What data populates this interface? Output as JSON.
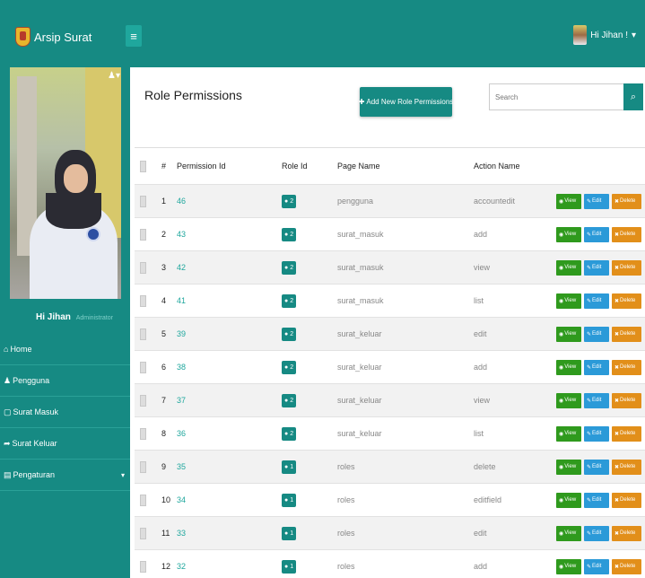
{
  "app": {
    "title": "Arsip Surat"
  },
  "navbar": {
    "menu_icon": "≡",
    "user_label": "Hi Jihan !",
    "user_caret": "▾"
  },
  "sidebar": {
    "greeting": "Hi Jihan",
    "role": "Administrator",
    "items": [
      {
        "label": "Home",
        "icon": "⌂"
      },
      {
        "label": "Pengguna",
        "icon": "♟"
      },
      {
        "label": "Surat Masuk",
        "icon": "▢"
      },
      {
        "label": "Surat Keluar",
        "icon": "➦"
      },
      {
        "label": "Pengaturan",
        "icon": "▤",
        "caret": "▾"
      }
    ]
  },
  "main": {
    "title": "Role Permissions",
    "add_button": "Add New Role Permissions",
    "add_icon": "✚",
    "search_placeholder": "Search",
    "search_icon": "⌕"
  },
  "table": {
    "headers": {
      "num": "#",
      "permission_id": "Permission Id",
      "role_id": "Role Id",
      "page_name": "Page Name",
      "action_name": "Action Name"
    },
    "buttons": {
      "view": "View",
      "edit": "Edit",
      "delete": "Delete"
    },
    "rows": [
      {
        "num": "1",
        "permission_id": "46",
        "role_id": "2",
        "page_name": "pengguna",
        "action_name": "accountedit"
      },
      {
        "num": "2",
        "permission_id": "43",
        "role_id": "2",
        "page_name": "surat_masuk",
        "action_name": "add"
      },
      {
        "num": "3",
        "permission_id": "42",
        "role_id": "2",
        "page_name": "surat_masuk",
        "action_name": "view"
      },
      {
        "num": "4",
        "permission_id": "41",
        "role_id": "2",
        "page_name": "surat_masuk",
        "action_name": "list"
      },
      {
        "num": "5",
        "permission_id": "39",
        "role_id": "2",
        "page_name": "surat_keluar",
        "action_name": "edit"
      },
      {
        "num": "6",
        "permission_id": "38",
        "role_id": "2",
        "page_name": "surat_keluar",
        "action_name": "add"
      },
      {
        "num": "7",
        "permission_id": "37",
        "role_id": "2",
        "page_name": "surat_keluar",
        "action_name": "view"
      },
      {
        "num": "8",
        "permission_id": "36",
        "role_id": "2",
        "page_name": "surat_keluar",
        "action_name": "list"
      },
      {
        "num": "9",
        "permission_id": "35",
        "role_id": "1",
        "page_name": "roles",
        "action_name": "delete"
      },
      {
        "num": "10",
        "permission_id": "34",
        "role_id": "1",
        "page_name": "roles",
        "action_name": "editfield"
      },
      {
        "num": "11",
        "permission_id": "33",
        "role_id": "1",
        "page_name": "roles",
        "action_name": "edit"
      },
      {
        "num": "12",
        "permission_id": "32",
        "role_id": "1",
        "page_name": "roles",
        "action_name": "add"
      }
    ]
  }
}
